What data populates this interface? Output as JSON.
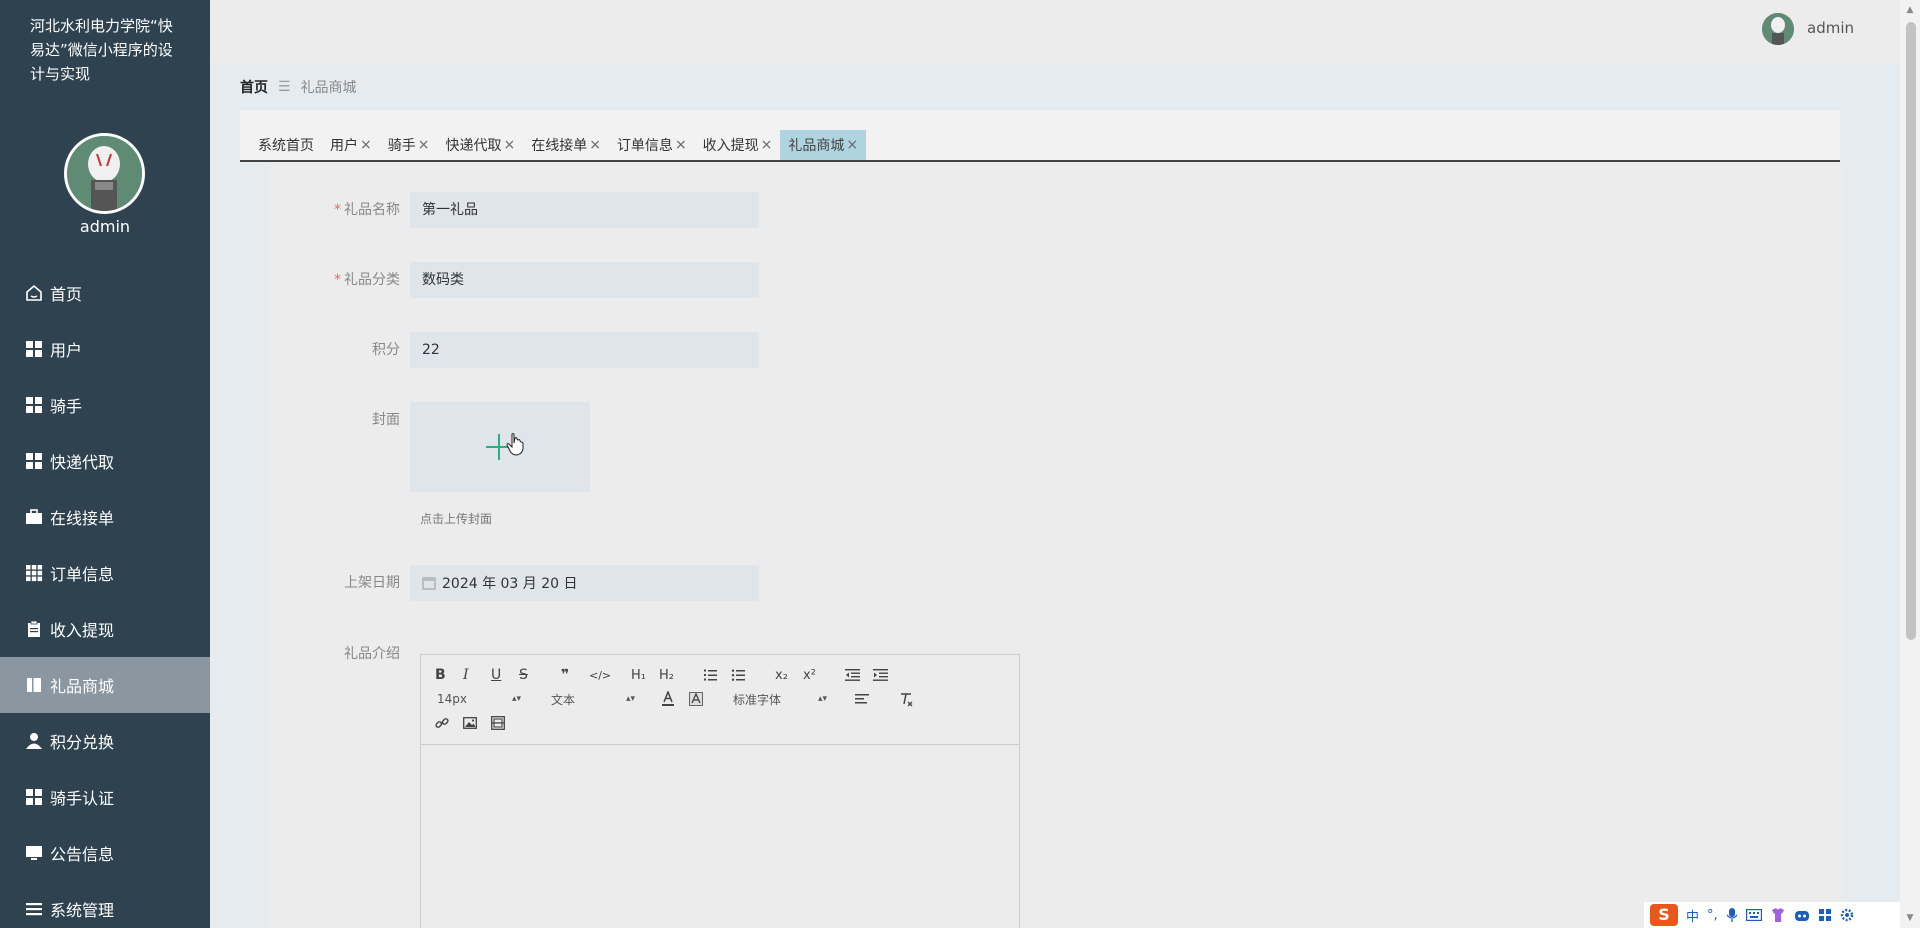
{
  "app": {
    "title": "河北水利电力学院“快易达”微信小程序的设计与实现"
  },
  "sidebar": {
    "username": "admin",
    "items": [
      {
        "label": "首页",
        "icon": "home-icon",
        "active": false
      },
      {
        "label": "用户",
        "icon": "grid-icon",
        "active": false
      },
      {
        "label": "骑手",
        "icon": "grid-icon",
        "active": false
      },
      {
        "label": "快递代取",
        "icon": "grid-icon",
        "active": false
      },
      {
        "label": "在线接单",
        "icon": "briefcase-icon",
        "active": false
      },
      {
        "label": "订单信息",
        "icon": "grid9-icon",
        "active": false
      },
      {
        "label": "收入提现",
        "icon": "clipboard-icon",
        "active": false
      },
      {
        "label": "礼品商城",
        "icon": "book-icon",
        "active": true
      },
      {
        "label": "积分兑换",
        "icon": "user-icon",
        "active": false
      },
      {
        "label": "骑手认证",
        "icon": "grid-icon",
        "active": false
      },
      {
        "label": "公告信息",
        "icon": "monitor-icon",
        "active": false
      },
      {
        "label": "系统管理",
        "icon": "list-icon",
        "active": false
      }
    ]
  },
  "header": {
    "username": "admin"
  },
  "breadcrumb": {
    "home": "首页",
    "separator": "☰",
    "current": "礼品商城"
  },
  "tabs": [
    {
      "label": "系统首页",
      "closable": false
    },
    {
      "label": "用户",
      "closable": true
    },
    {
      "label": "骑手",
      "closable": true
    },
    {
      "label": "快递代取",
      "closable": true
    },
    {
      "label": "在线接单",
      "closable": true
    },
    {
      "label": "订单信息",
      "closable": true
    },
    {
      "label": "收入提现",
      "closable": true
    },
    {
      "label": "礼品商城",
      "closable": true,
      "active": true
    }
  ],
  "tab_close_glyph": "×",
  "form": {
    "name_label": "礼品名称",
    "name_value": "第一礼品",
    "category_label": "礼品分类",
    "category_value": "数码类",
    "points_label": "积分",
    "points_value": "22",
    "cover_label": "封面",
    "cover_hint": "点击上传封面",
    "date_label": "上架日期",
    "date_value": "2024 年 03 月 20 日",
    "intro_label": "礼品介绍",
    "required_mark": "*"
  },
  "editor": {
    "font_size": "14px",
    "header_select": "文本",
    "font_family": "标准字体"
  },
  "ime": {
    "mode": "中"
  },
  "colors": {
    "sidebar_bg": "#2e4250",
    "active_tab": "#aed4e0",
    "accent_plus": "#2ab07a"
  }
}
